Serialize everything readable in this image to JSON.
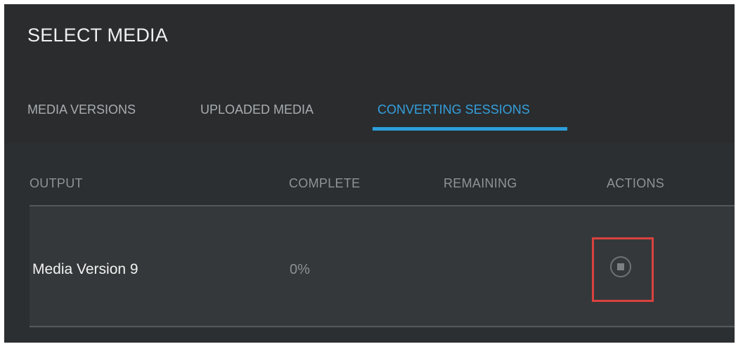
{
  "dialog": {
    "title": "SELECT MEDIA"
  },
  "tabs": [
    {
      "label": "MEDIA VERSIONS",
      "active": false
    },
    {
      "label": "UPLOADED MEDIA",
      "active": false
    },
    {
      "label": "CONVERTING SESSIONS",
      "active": true
    }
  ],
  "table": {
    "columns": [
      "OUTPUT",
      "COMPLETE",
      "REMAINING",
      "ACTIONS"
    ],
    "rows": [
      {
        "output": "Media Version 9",
        "complete": "0%",
        "remaining": "",
        "action_icon": "stop-icon"
      }
    ]
  },
  "colors": {
    "accent": "#2d9fdc",
    "highlight": "#d9423f",
    "background": "#2c2f31"
  }
}
